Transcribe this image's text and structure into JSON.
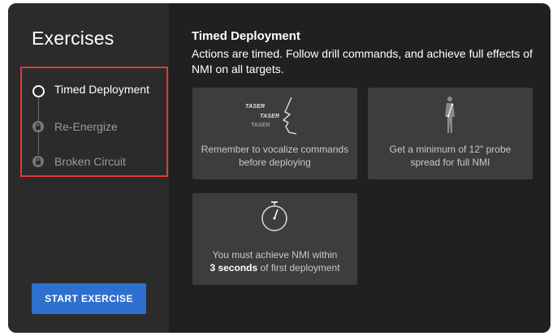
{
  "sidebar": {
    "title": "Exercises",
    "exercises": [
      {
        "label": "Timed Deployment",
        "state": "active",
        "icon": "radio-ring-icon"
      },
      {
        "label": "Re-Energize",
        "state": "locked",
        "icon": "lock-icon"
      },
      {
        "label": "Broken Circuit",
        "state": "locked",
        "icon": "lock-icon"
      }
    ],
    "start_button_label": "START EXERCISE"
  },
  "main": {
    "title": "Timed Deployment",
    "description": "Actions are timed. Follow drill commands, and achieve full effects of NMI on all targets.",
    "cards": [
      {
        "icon": "taser-voice-icon",
        "taser_words": [
          "TASER",
          "TASER",
          "TASER"
        ],
        "text": "Remember to vocalize commands before deploying"
      },
      {
        "icon": "probe-spread-figure-icon",
        "text": "Get a minimum of 12\" probe spread for full NMI"
      },
      {
        "icon": "stopwatch-icon",
        "text_prefix": "You must achieve NMI within",
        "text_bold": "3 seconds",
        "text_suffix": "of first deployment"
      }
    ]
  },
  "colors": {
    "background": "#202020",
    "sidebar": "#2b2b2b",
    "card": "#3d3d3d",
    "accent_button": "#2f6fce",
    "selection_outline": "#e53935",
    "locked_text": "#9a9a9a"
  }
}
